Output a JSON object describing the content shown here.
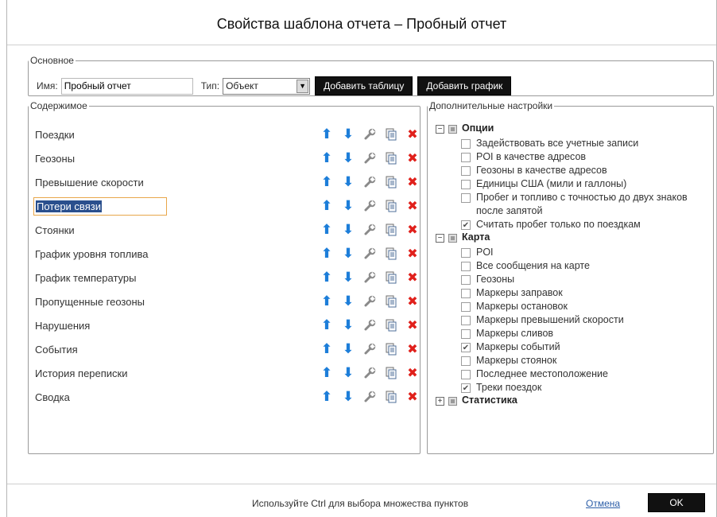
{
  "dialog": {
    "title": "Свойства шаблона отчета – Пробный отчет"
  },
  "basic": {
    "legend": "Основное",
    "name_label": "Имя:",
    "name_value": "Пробный отчет",
    "type_label": "Тип:",
    "type_value": "Объект",
    "add_table_label": "Добавить таблицу",
    "add_chart_label": "Добавить график"
  },
  "content": {
    "legend": "Содержимое",
    "items": [
      {
        "label": "Поездки"
      },
      {
        "label": "Геозоны"
      },
      {
        "label": "Превышение скорости"
      },
      {
        "label": "Потери связи"
      },
      {
        "label": "Стоянки"
      },
      {
        "label": "График уровня топлива"
      },
      {
        "label": "График температуры"
      },
      {
        "label": "Пропущенные геозоны"
      },
      {
        "label": "Нарушения"
      },
      {
        "label": "События"
      },
      {
        "label": "История переписки"
      },
      {
        "label": "Сводка"
      }
    ],
    "editing_index": 3,
    "icons": {
      "up": "arrow-up-icon",
      "down": "arrow-down-icon",
      "settings": "wrench-icon",
      "copy": "copy-icon",
      "delete": "delete-icon"
    }
  },
  "settings": {
    "legend": "Дополнительные настройки",
    "groups": [
      {
        "label": "Опции",
        "expanded": true,
        "items": [
          {
            "label": "Задействовать все учетные записи",
            "checked": false
          },
          {
            "label": "POI в качестве адресов",
            "checked": false
          },
          {
            "label": "Геозоны в качестве адресов",
            "checked": false
          },
          {
            "label": "Единицы США (мили и галлоны)",
            "checked": false
          },
          {
            "label": "Пробег и топливо с точностью до двух знаков после запятой",
            "checked": false
          },
          {
            "label": "Считать пробег только по поездкам",
            "checked": true
          }
        ]
      },
      {
        "label": "Карта",
        "expanded": true,
        "items": [
          {
            "label": "POI",
            "checked": false
          },
          {
            "label": "Все сообщения на карте",
            "checked": false
          },
          {
            "label": "Геозоны",
            "checked": false
          },
          {
            "label": "Маркеры заправок",
            "checked": false
          },
          {
            "label": "Маркеры остановок",
            "checked": false
          },
          {
            "label": "Маркеры превышений скорости",
            "checked": false
          },
          {
            "label": "Маркеры сливов",
            "checked": false
          },
          {
            "label": "Маркеры событий",
            "checked": true
          },
          {
            "label": "Маркеры стоянок",
            "checked": false
          },
          {
            "label": "Последнее местоположение",
            "checked": false
          },
          {
            "label": "Треки поездок",
            "checked": true
          }
        ]
      },
      {
        "label": "Статистика",
        "expanded": false,
        "items": []
      }
    ]
  },
  "footer": {
    "hint": "Используйте Ctrl для выбора множества пунктов",
    "cancel_label": "Отмена",
    "ok_label": "OK"
  },
  "colors": {
    "arrow": "#1d7ed9",
    "delete": "#e0201b",
    "selection": "#2a4f8d",
    "focus_border": "#e8a64a",
    "link": "#2c5ea8"
  }
}
